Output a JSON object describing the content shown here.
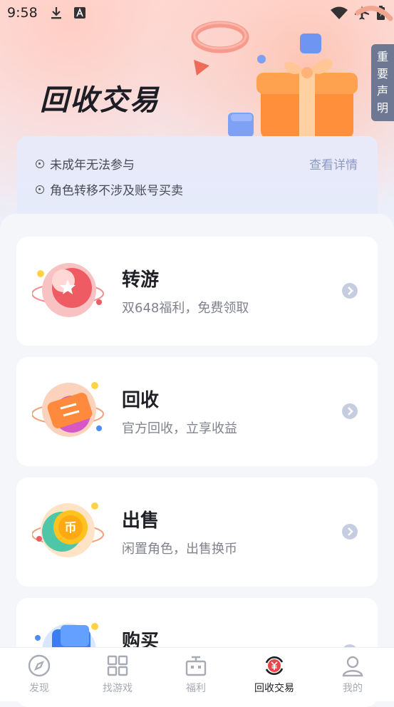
{
  "status": {
    "time": "9:58"
  },
  "header": {
    "title": "回收交易",
    "side_tab": "重要声明"
  },
  "notice": {
    "items": [
      "未成年无法参与",
      "角色转移不涉及账号买卖"
    ],
    "detail_link": "查看详情"
  },
  "cards": [
    {
      "name": "转游",
      "desc": "双648福利，免费领取",
      "icon": "star-badge-icon"
    },
    {
      "name": "回收",
      "desc": "官方回收，立享收益",
      "icon": "exchange-ticket-icon"
    },
    {
      "name": "出售",
      "desc": "闲置角色，出售换币",
      "icon": "coin-icon"
    },
    {
      "name": "购买",
      "desc": "",
      "icon": "wallet-icon"
    }
  ],
  "tabs": [
    {
      "label": "发现",
      "icon": "compass-icon"
    },
    {
      "label": "找游戏",
      "icon": "grid-icon"
    },
    {
      "label": "福利",
      "icon": "gift-box-icon"
    },
    {
      "label": "回收交易",
      "icon": "yuan-exchange-icon"
    },
    {
      "label": "我的",
      "icon": "user-icon"
    }
  ],
  "colors": {
    "accent": "#e8474a",
    "link": "#8e9ac0",
    "tab_inactive": "#a8abb3"
  }
}
